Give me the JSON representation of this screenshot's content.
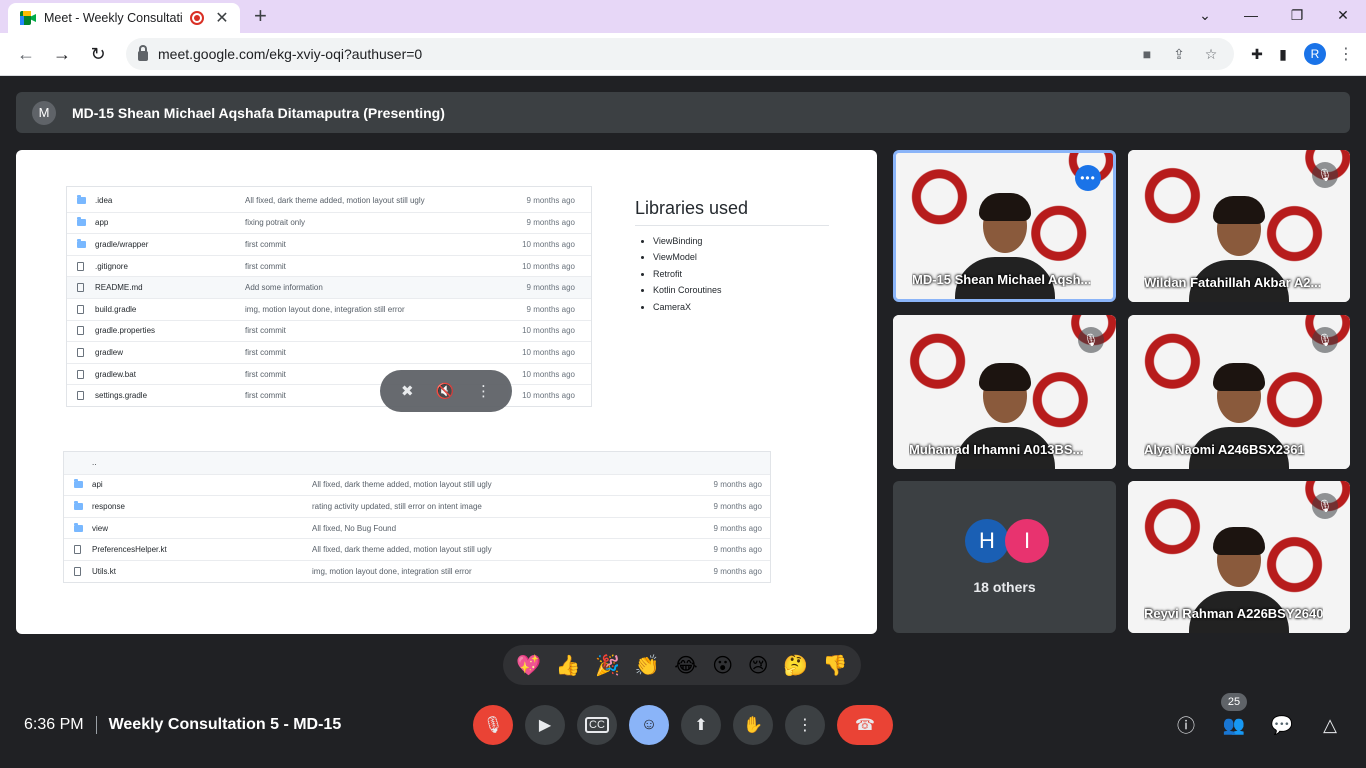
{
  "browser": {
    "tab_title": "Meet - Weekly Consultation",
    "url": "meet.google.com/ekg-xviy-oqi?authuser=0",
    "profile_initial": "R"
  },
  "presenter": {
    "initial": "M",
    "text": "MD-15 Shean Michael Aqshafa Ditamaputra (Presenting)"
  },
  "slide": {
    "table1": [
      {
        "type": "folder",
        "name": ".idea",
        "msg": "All fixed, dark theme added, motion layout still ugly",
        "time": "9 months ago"
      },
      {
        "type": "folder",
        "name": "app",
        "msg": "fixing potrait only",
        "time": "9 months ago"
      },
      {
        "type": "folder",
        "name": "gradle/wrapper",
        "msg": "first commit",
        "time": "10 months ago"
      },
      {
        "type": "file",
        "name": ".gitignore",
        "msg": "first commit",
        "time": "10 months ago"
      },
      {
        "type": "file",
        "name": "README.md",
        "msg": "Add some information",
        "time": "9 months ago",
        "hl": true
      },
      {
        "type": "file",
        "name": "build.gradle",
        "msg": "img, motion layout done, integration still error",
        "time": "9 months ago"
      },
      {
        "type": "file",
        "name": "gradle.properties",
        "msg": "first commit",
        "time": "10 months ago"
      },
      {
        "type": "file",
        "name": "gradlew",
        "msg": "first commit",
        "time": "10 months ago"
      },
      {
        "type": "file",
        "name": "gradlew.bat",
        "msg": "first commit",
        "time": "10 months ago"
      },
      {
        "type": "file",
        "name": "settings.gradle",
        "msg": "first commit",
        "time": "10 months ago"
      }
    ],
    "table2": [
      {
        "type": "parent",
        "name": "..",
        "msg": "",
        "time": "",
        "hl": true
      },
      {
        "type": "folder",
        "name": "api",
        "msg": "All fixed, dark theme added, motion layout still ugly",
        "time": "9 months ago"
      },
      {
        "type": "folder",
        "name": "response",
        "msg": "rating activity updated, still error on intent image",
        "time": "9 months ago"
      },
      {
        "type": "folder",
        "name": "view",
        "msg": "All fixed, No Bug Found",
        "time": "9 months ago"
      },
      {
        "type": "file",
        "name": "PreferencesHelper.kt",
        "msg": "All fixed, dark theme added, motion layout still ugly",
        "time": "9 months ago"
      },
      {
        "type": "file",
        "name": "Utils.kt",
        "msg": "img, motion layout done, integration still error",
        "time": "9 months ago"
      }
    ],
    "libraries_title": "Libraries used",
    "libraries": [
      "ViewBinding",
      "ViewModel",
      "Retrofit",
      "Kotlin Coroutines",
      "CameraX"
    ]
  },
  "tiles": [
    {
      "name": "MD-15 Shean Michael Aqsh...",
      "badge": "more"
    },
    {
      "name": "Wildan Fatahillah Akbar A2...",
      "badge": "mute"
    },
    {
      "name": "Muhamad Irhamni A013BS...",
      "badge": "mute"
    },
    {
      "name": "Alya Naomi A246BSX2361",
      "badge": "mute"
    },
    {
      "name": "Reyvi Rahman A226BSY2640",
      "badge": "mute"
    }
  ],
  "others": {
    "avatars": [
      {
        "initial": "H",
        "color": "#1a5fb4"
      },
      {
        "initial": "I",
        "color": "#e8336f"
      }
    ],
    "label": "18 others"
  },
  "reactions": [
    "💖",
    "👍",
    "🎉",
    "👏",
    "😂",
    "😮",
    "😢",
    "🤔",
    "👎"
  ],
  "meeting": {
    "time": "6:36 PM",
    "title": "Weekly Consultation 5 - MD-15"
  },
  "people_count": "25"
}
